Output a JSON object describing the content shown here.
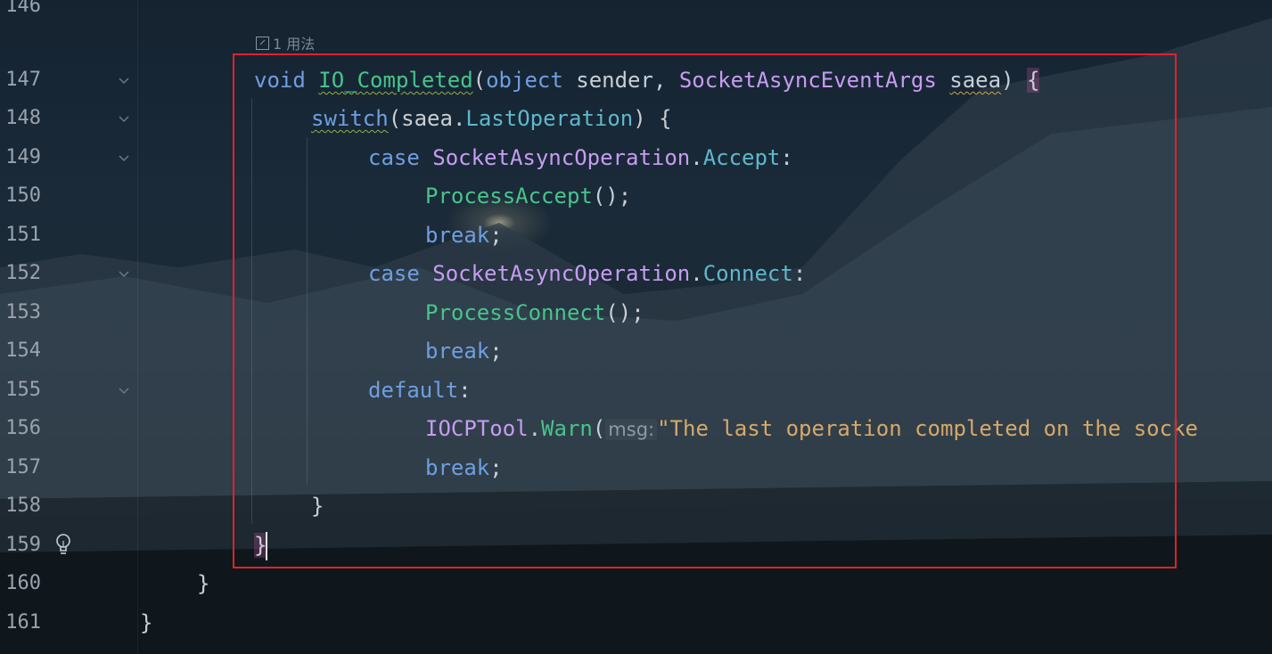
{
  "editor": {
    "usage_hint": "1 用法",
    "line_numbers": [
      "146",
      "147",
      "148",
      "149",
      "150",
      "151",
      "152",
      "153",
      "154",
      "155",
      "156",
      "157",
      "158",
      "159",
      "160",
      "161"
    ],
    "code": {
      "l147": {
        "kw_void": "void",
        "fn_name": "IO_Completed",
        "open": "(",
        "kw_object": "object",
        "p1": " sender, ",
        "ty_args": "SocketAsyncEventArgs",
        "sp": " ",
        "p_saea": "saea",
        "close": ") ",
        "brace": "{"
      },
      "l148": {
        "kw_switch": "switch",
        "rest": "(saea.",
        "mem": "LastOperation",
        "end": ") {"
      },
      "l149": {
        "kw_case": "case",
        "sp": " ",
        "ty": "SocketAsyncOperation",
        "dot": ".",
        "mem": "Accept",
        "colon": ":"
      },
      "l150": {
        "fn": "ProcessAccept",
        "end": "();"
      },
      "l151": {
        "kw": "break",
        "end": ";"
      },
      "l152": {
        "kw_case": "case",
        "sp": " ",
        "ty": "SocketAsyncOperation",
        "dot": ".",
        "mem": "Connect",
        "colon": ":"
      },
      "l153": {
        "fn": "ProcessConnect",
        "end": "();"
      },
      "l154": {
        "kw": "break",
        "end": ";"
      },
      "l155": {
        "kw": "default",
        "end": ":"
      },
      "l156": {
        "ty": "IOCPTool",
        "dot": ".",
        "fn": "Warn",
        "open": "(",
        "hint": "msg:",
        "str": "\"The last operation completed on the socke"
      },
      "l157": {
        "kw": "break",
        "end": ";"
      },
      "l158": {
        "brace": "}"
      },
      "l159": {
        "brace": "}"
      },
      "l160": {
        "brace": "}"
      },
      "l161": {
        "brace": "}"
      }
    }
  },
  "colors": {
    "keyword": "#6f9fe0",
    "function": "#48c48c",
    "type": "#c79cf2",
    "member": "#5fb8cc",
    "string": "#d8a869",
    "highlight_box": "#e0222b"
  }
}
